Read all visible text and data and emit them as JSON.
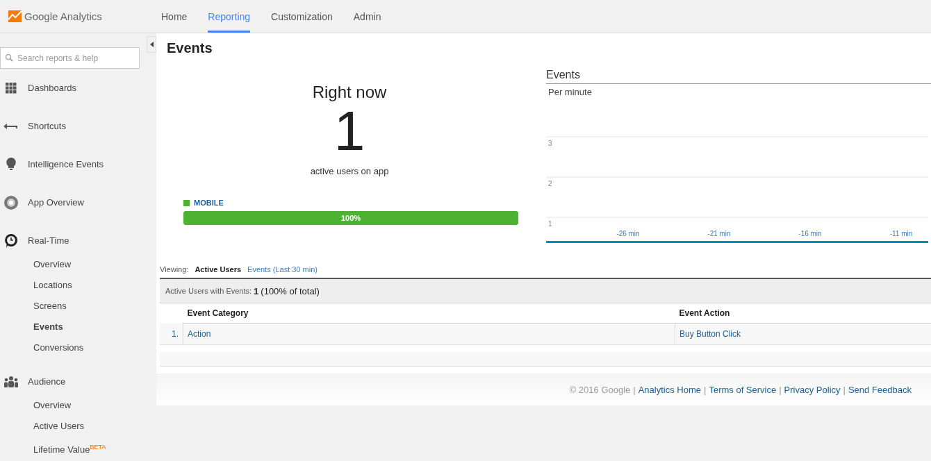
{
  "header": {
    "logo": "Google Analytics",
    "nav": [
      {
        "label": "Home",
        "selected": false
      },
      {
        "label": "Reporting",
        "selected": true
      },
      {
        "label": "Customization",
        "selected": false
      },
      {
        "label": "Admin",
        "selected": false
      }
    ]
  },
  "sidebar": {
    "search": {
      "placeholder": "Search reports & help"
    },
    "items": [
      {
        "label": "Dashboards"
      },
      {
        "label": "Shortcuts"
      },
      {
        "label": "Intelligence Events"
      },
      {
        "label": "App Overview"
      },
      {
        "label": "Real-Time",
        "children": [
          {
            "label": "Overview",
            "selected": false
          },
          {
            "label": "Locations",
            "selected": false
          },
          {
            "label": "Screens",
            "selected": false
          },
          {
            "label": "Events",
            "selected": true
          },
          {
            "label": "Conversions",
            "selected": false
          }
        ]
      },
      {
        "label": "Audience",
        "children": [
          {
            "label": "Overview",
            "selected": false
          },
          {
            "label": "Active Users",
            "selected": false
          },
          {
            "label": "Lifetime Value",
            "badge": "BETA",
            "selected": false
          }
        ]
      }
    ]
  },
  "page": {
    "title": "Events",
    "right_now": {
      "heading": "Right now",
      "count": "1",
      "caption": "active users on app",
      "segment": {
        "label": "MOBILE",
        "color": "#4db131",
        "level": 1,
        "reading": "100%"
      }
    },
    "chart": {
      "title": "Events",
      "subtitle": "Per minute",
      "y_labels": [
        "3",
        "2",
        "1"
      ],
      "x_labels": [
        "-26 min",
        "-21 min",
        "-16 min",
        "-11 min"
      ]
    },
    "viewing": {
      "label": "Viewing:",
      "tabs": [
        {
          "label": "Active Users",
          "selected": true
        },
        {
          "label": "Events (Last 30 min)",
          "selected": false
        }
      ]
    },
    "summary": {
      "label": "Active Users with Events:",
      "value": "1",
      "share": "(100% of total)"
    },
    "table": {
      "columns": [
        "Event Category",
        "Event Action"
      ],
      "rows": [
        {
          "index": "1.",
          "cells": [
            "Action",
            "Buy Button Click"
          ]
        }
      ]
    }
  },
  "footer": {
    "copyright": "© 2016 Google",
    "separator": "|",
    "links": [
      "Analytics Home",
      "Terms of Service",
      "Privacy Policy",
      "Send Feedback"
    ]
  }
}
